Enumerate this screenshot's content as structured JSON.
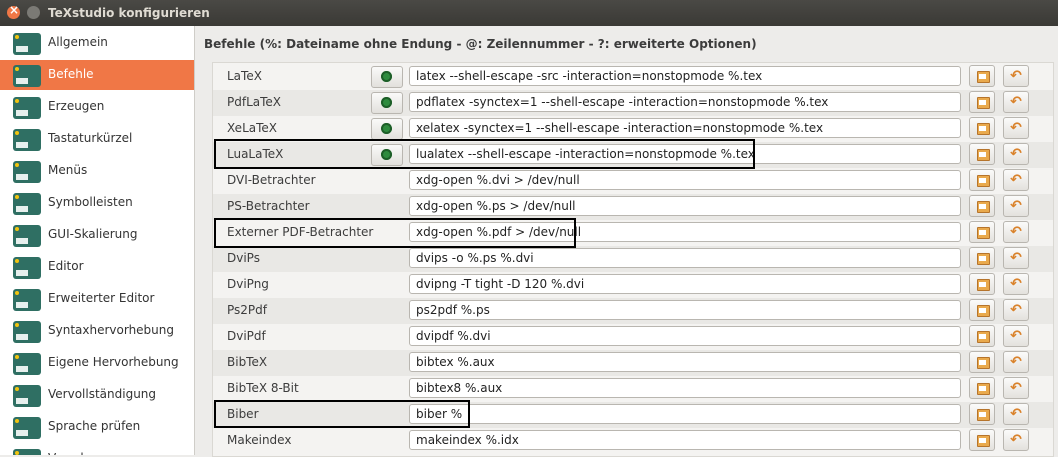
{
  "window": {
    "title": "TeXstudio konfigurieren"
  },
  "sidebar": {
    "items": [
      {
        "label": "Allgemein",
        "icon": "txs-logo-icon",
        "active": false
      },
      {
        "label": "Befehle",
        "icon": "latex-icon",
        "active": true
      },
      {
        "label": "Erzeugen",
        "icon": "build-icon",
        "active": false
      },
      {
        "label": "Tastaturkürzel",
        "icon": "keyboard-icon",
        "active": false
      },
      {
        "label": "Menüs",
        "icon": "menu-icon",
        "active": false
      },
      {
        "label": "Symbolleisten",
        "icon": "toolbar-icon",
        "active": false
      },
      {
        "label": "GUI-Skalierung",
        "icon": "scaling-icon",
        "active": false
      },
      {
        "label": "Editor",
        "icon": "editor-icon",
        "active": false
      },
      {
        "label": "Erweiterter Editor",
        "icon": "advanced-editor-icon",
        "active": false
      },
      {
        "label": "Syntaxhervorhebung",
        "icon": "syntax-icon",
        "active": false
      },
      {
        "label": "Eigene Hervorhebung",
        "icon": "highlight-icon",
        "active": false
      },
      {
        "label": "Vervollständigung",
        "icon": "completion-icon",
        "active": false
      },
      {
        "label": "Sprache prüfen",
        "icon": "spellcheck-icon",
        "active": false
      },
      {
        "label": "Vorschau",
        "icon": "preview-icon",
        "active": false
      }
    ]
  },
  "main": {
    "heading": "Befehle (%: Dateiname ohne Endung - @: Zeilennummer - ?: erweiterte Optionen)",
    "commands": [
      {
        "name": "LaTeX",
        "command": "latex --shell-escape -src -interaction=nonstopmode %.tex",
        "has_run": true
      },
      {
        "name": "PdfLaTeX",
        "command": "pdflatex -synctex=1 --shell-escape -interaction=nonstopmode %.tex",
        "has_run": true
      },
      {
        "name": "XeLaTeX",
        "command": "xelatex -synctex=1 --shell-escape -interaction=nonstopmode %.tex",
        "has_run": true
      },
      {
        "name": "LuaLaTeX",
        "command": "lualatex --shell-escape  -interaction=nonstopmode %.tex",
        "has_run": true
      },
      {
        "name": "DVI-Betrachter",
        "command": "xdg-open %.dvi > /dev/null",
        "has_run": false
      },
      {
        "name": "PS-Betrachter",
        "command": "xdg-open %.ps > /dev/null",
        "has_run": false
      },
      {
        "name": "Externer PDF-Betrachter",
        "command": "xdg-open %.pdf > /dev/null",
        "has_run": false
      },
      {
        "name": "DviPs",
        "command": "dvips -o %.ps %.dvi",
        "has_run": false
      },
      {
        "name": "DviPng",
        "command": "dvipng -T tight -D 120 %.dvi",
        "has_run": false
      },
      {
        "name": "Ps2Pdf",
        "command": "ps2pdf %.ps",
        "has_run": false
      },
      {
        "name": "DviPdf",
        "command": "dvipdf %.dvi",
        "has_run": false
      },
      {
        "name": "BibTeX",
        "command": "bibtex %.aux",
        "has_run": false
      },
      {
        "name": "BibTeX 8-Bit",
        "command": "bibtex8 %.aux",
        "has_run": false
      },
      {
        "name": "Biber",
        "command": "biber %",
        "has_run": false
      },
      {
        "name": "Makeindex",
        "command": "makeindex %.idx",
        "has_run": false
      }
    ]
  },
  "colors": {
    "accent": "#f07746",
    "titlebar": "#3e3d39"
  }
}
